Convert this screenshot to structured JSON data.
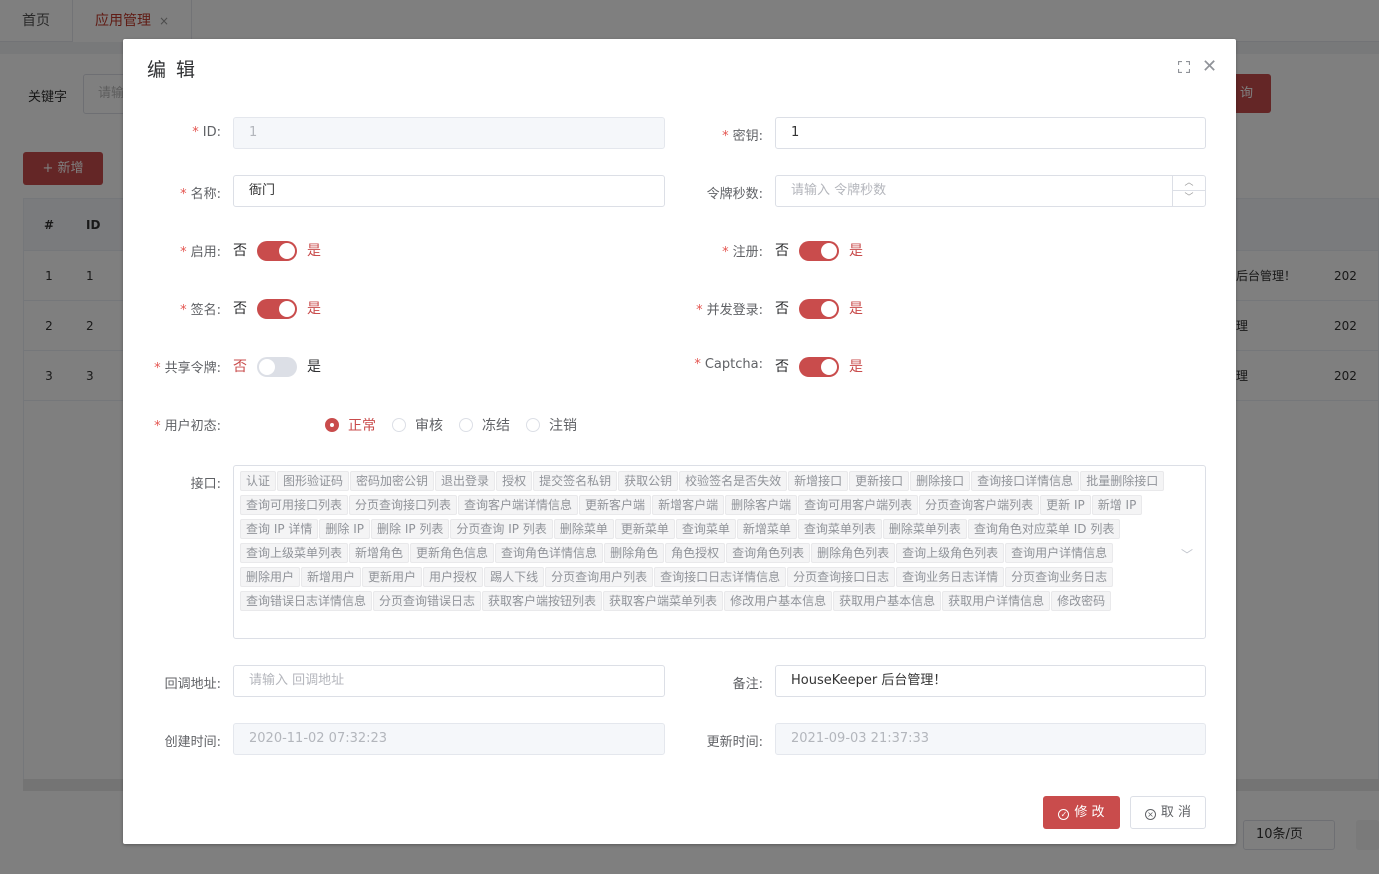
{
  "tabs": [
    {
      "label": "首页"
    },
    {
      "label": "应用管理",
      "close": "×"
    }
  ],
  "background": {
    "keyword_label": "关键字",
    "keyword_placeholder": "请输",
    "search_label": "询",
    "add_label": "+ 新增",
    "table": {
      "headers": [
        "#",
        "ID"
      ],
      "rows": [
        {
          "idx": "1",
          "id": "1",
          "remark": "后台管理！",
          "time": "202"
        },
        {
          "idx": "2",
          "id": "2",
          "remark": "理",
          "time": "202"
        },
        {
          "idx": "3",
          "id": "3",
          "remark": "理",
          "time": "202"
        }
      ]
    },
    "page_size": "10条/页"
  },
  "dialog": {
    "title": "编 辑",
    "fields": {
      "id": {
        "label": "ID:",
        "value": "1"
      },
      "secret": {
        "label": "密钥:",
        "value": "1"
      },
      "name": {
        "label": "名称:",
        "value": "衙门"
      },
      "token_seconds": {
        "label": "令牌秒数:",
        "placeholder": "请输入 令牌秒数"
      },
      "enabled": {
        "label": "启用:",
        "off": "否",
        "on": "是",
        "state": true
      },
      "register": {
        "label": "注册:",
        "off": "否",
        "on": "是",
        "state": true
      },
      "sign": {
        "label": "签名:",
        "off": "否",
        "on": "是",
        "state": true
      },
      "concurrent_login": {
        "label": "并发登录:",
        "off": "否",
        "on": "是",
        "state": true
      },
      "shared_token": {
        "label": "共享令牌:",
        "off": "否",
        "on": "是",
        "state": false
      },
      "captcha": {
        "label": "Captcha:",
        "off": "否",
        "on": "是",
        "state": true
      },
      "user_initial_state": {
        "label": "用户初态:",
        "options": [
          "正常",
          "审核",
          "冻结",
          "注销"
        ],
        "selected": "正常"
      },
      "apis": {
        "label": "接口:",
        "tags": [
          "认证",
          "图形验证码",
          "密码加密公钥",
          "退出登录",
          "授权",
          "提交签名私钥",
          "获取公钥",
          "校验签名是否失效",
          "新增接口",
          "更新接口",
          "删除接口",
          "查询接口详情信息",
          "批量删除接口",
          "查询可用接口列表",
          "分页查询接口列表",
          "查询客户端详情信息",
          "更新客户端",
          "新增客户端",
          "删除客户端",
          "查询可用客户端列表",
          "分页查询客户端列表",
          "更新 IP",
          "新增 IP",
          "查询 IP 详情",
          "删除 IP",
          "删除 IP 列表",
          "分页查询 IP 列表",
          "删除菜单",
          "更新菜单",
          "查询菜单",
          "新增菜单",
          "查询菜单列表",
          "删除菜单列表",
          "查询角色对应菜单 ID 列表",
          "查询上级菜单列表",
          "新增角色",
          "更新角色信息",
          "查询角色详情信息",
          "删除角色",
          "角色授权",
          "查询角色列表",
          "删除角色列表",
          "查询上级角色列表",
          "查询用户详情信息",
          "删除用户",
          "新增用户",
          "更新用户",
          "用户授权",
          "踢人下线",
          "分页查询用户列表",
          "查询接口日志详情信息",
          "分页查询接口日志",
          "查询业务日志详情",
          "分页查询业务日志",
          "查询错误日志详情信息",
          "分页查询错误日志",
          "获取客户端按钮列表",
          "获取客户端菜单列表",
          "修改用户基本信息",
          "获取用户基本信息",
          "获取用户详情信息",
          "修改密码"
        ]
      },
      "callback_url": {
        "label": "回调地址:",
        "placeholder": "请输入 回调地址"
      },
      "remark": {
        "label": "备注:",
        "value": "HouseKeeper 后台管理！"
      },
      "created_at": {
        "label": "创建时间:",
        "value": "2020-11-02 07:32:23"
      },
      "updated_at": {
        "label": "更新时间:",
        "value": "2021-09-03 21:37:33"
      }
    },
    "buttons": {
      "submit": "修 改",
      "cancel": "取 消"
    }
  },
  "colors": {
    "accent": "#c94c4c",
    "required": "#e4544f"
  }
}
